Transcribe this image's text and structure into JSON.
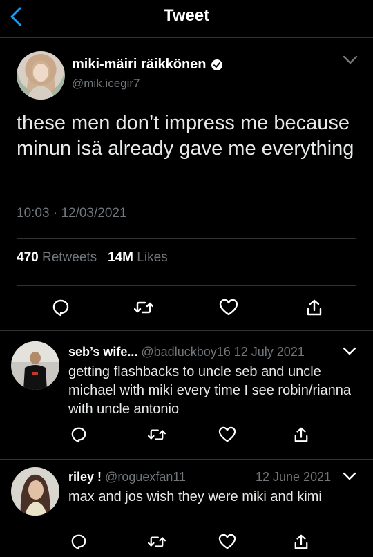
{
  "header": {
    "title": "Tweet",
    "back_icon": "chevron-left-icon",
    "accent_color": "#1d9bf0"
  },
  "tweet": {
    "author_name": "miki-mäiri räikkönen",
    "author_handle": "@mik.icegir7",
    "verified_icon": "verified-badge-icon",
    "text": "these men don’t impress me because minun isä already gave me everything",
    "time": "10:03",
    "separator": "·",
    "date": "12/03/2021",
    "retweet_count": "470",
    "retweet_label": "Retweets",
    "like_count": "14M",
    "like_label": "Likes"
  },
  "actions": {
    "reply_icon": "reply-icon",
    "retweet_icon": "retweet-icon",
    "like_icon": "heart-icon",
    "share_icon": "share-icon"
  },
  "replies": [
    {
      "name": "seb’s wife...",
      "handle": "@badluckboy16",
      "date": "12 July 2021",
      "text": "getting flashbacks to uncle seb and uncle michael with miki every time I see robin/rianna with uncle antonio"
    },
    {
      "name": "riley !",
      "handle": "@roguexfan11",
      "date": "12 June 2021",
      "text": "max and jos wish they were miki and kimi"
    }
  ]
}
